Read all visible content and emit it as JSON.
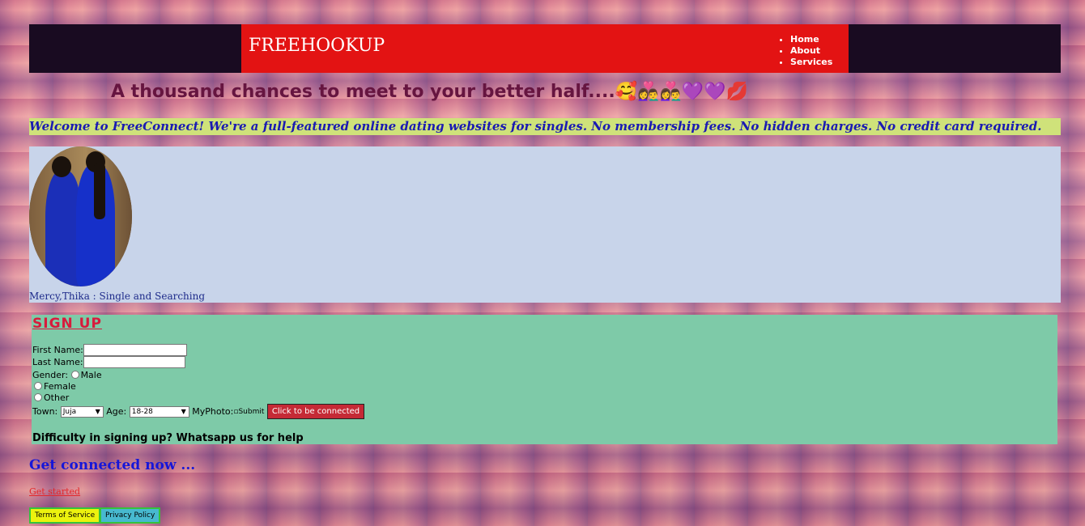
{
  "header": {
    "brand": "FREEHOOKUP",
    "nav": [
      "Home",
      "About",
      "Services"
    ]
  },
  "tagline": "A thousand chances to meet to your better half....🥰👩‍❤️‍👨👩‍❤️‍👨💜💜💋",
  "welcome": "Welcome to FreeConnect! We're a full-featured online dating websites for singles. No membership fees. No hidden charges. No credit card required.",
  "profile": {
    "caption": "Mercy,Thika : Single and Searching"
  },
  "signup": {
    "title": "SIGN UP",
    "first_name_label": "First Name:",
    "last_name_label": "Last Name:",
    "gender_label": "Gender:",
    "gender_options": [
      "Male",
      "Female",
      "Other"
    ],
    "town_label": "Town:",
    "town_value": "Juja",
    "age_label": "Age:",
    "age_value": "18-28",
    "photo_label": "MyPhoto:",
    "submit_image_alt": "Submit",
    "connect_button": "Click to be connected",
    "help_text": "Difficulty in signing up? Whatsapp us for help"
  },
  "get_connected": "Get connected now ...",
  "get_started": "Get started",
  "footer": {
    "terms": "Terms of Service",
    "privacy": "Privacy Policy"
  }
}
